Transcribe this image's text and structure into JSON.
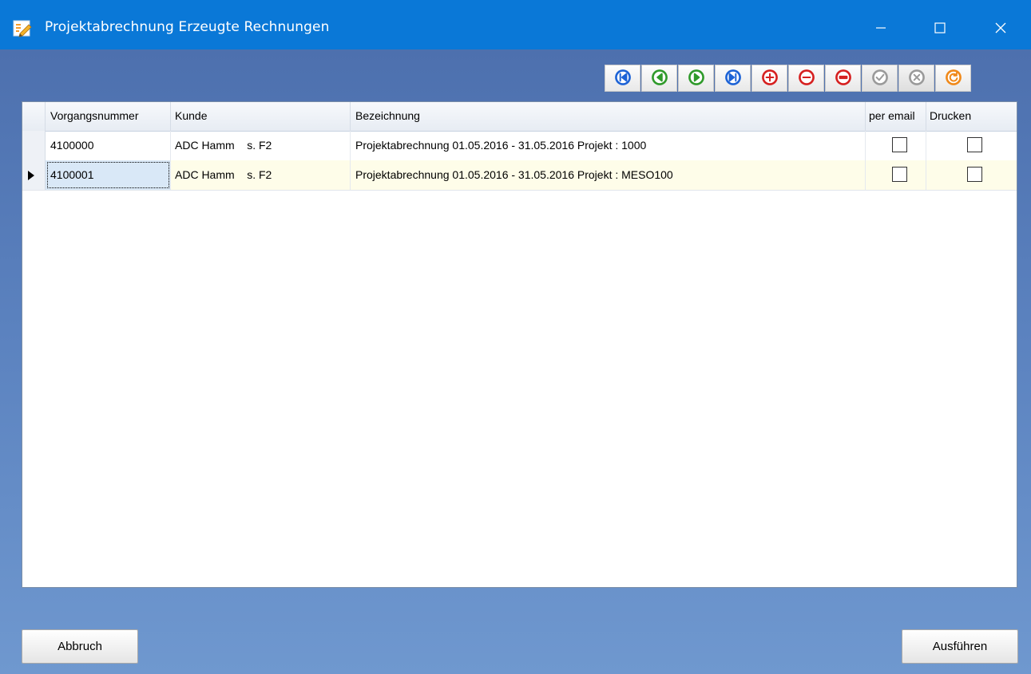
{
  "window": {
    "title": "Projektabrechnung Erzeugte Rechnungen",
    "title_bar_color": "#0a78d7"
  },
  "toolbar": {
    "buttons": [
      {
        "icon": "first-record-icon",
        "color": "#1d63d6",
        "enabled": true
      },
      {
        "icon": "previous-record-icon",
        "color": "#2f9a2b",
        "enabled": true
      },
      {
        "icon": "next-record-icon",
        "color": "#2f9a2b",
        "enabled": true
      },
      {
        "icon": "last-record-icon",
        "color": "#1d63d6",
        "enabled": true
      },
      {
        "icon": "add-record-icon",
        "color": "#d62020",
        "enabled": true
      },
      {
        "icon": "delete-record-icon",
        "color": "#d62020",
        "enabled": true
      },
      {
        "icon": "edit-record-icon",
        "color": "#d62020",
        "enabled": true
      },
      {
        "icon": "post-record-icon",
        "color": "#9a9a9a",
        "enabled": false
      },
      {
        "icon": "cancel-record-icon",
        "color": "#9a9a9a",
        "enabled": false
      },
      {
        "icon": "refresh-record-icon",
        "color": "#f0891a",
        "enabled": true
      }
    ]
  },
  "grid": {
    "columns": [
      "Vorgangsnummer",
      "Kunde",
      "Bezeichnung",
      "per email",
      "Drucken"
    ],
    "rows": [
      {
        "vorgangsnummer": "4100000",
        "kunde": "ADC Hamm    s. F2",
        "bezeichnung": "Projektabrechnung 01.05.2016 - 31.05.2016 Projekt : 1000",
        "per_email": false,
        "drucken": false
      },
      {
        "vorgangsnummer": "4100001",
        "kunde": "ADC Hamm    s. F2",
        "bezeichnung": "Projektabrechnung 01.05.2016 - 31.05.2016 Projekt : MESO100",
        "per_email": false,
        "drucken": false
      }
    ],
    "selected_row_color": "#fefde9"
  },
  "footer": {
    "cancel_label": "Abbruch",
    "execute_label": "Ausführen"
  }
}
